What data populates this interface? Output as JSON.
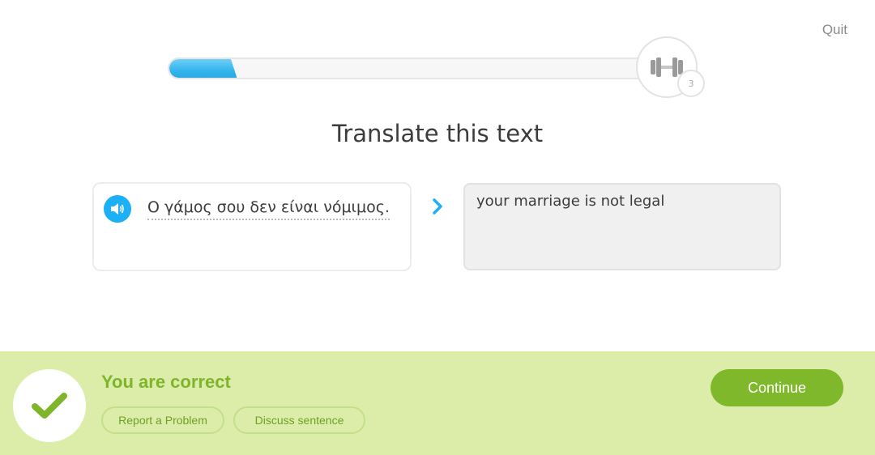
{
  "header": {
    "quit_label": "Quit",
    "progress": 0.14,
    "strength_icon": "dumbbell-icon",
    "strength_count": "3"
  },
  "exercise": {
    "title": "Translate this text",
    "prompt_text": "Ο γάμος σου δεν είναι νόμιμος.",
    "speaker_icon": "speaker-icon",
    "arrow_icon": "chevron-right-icon",
    "answer_text": "your marriage is not legal"
  },
  "result": {
    "status_icon": "checkmark-icon",
    "title": "You are correct",
    "report_label": "Report a Problem",
    "discuss_label": "Discuss sentence",
    "continue_label": "Continue"
  },
  "colors": {
    "progress_blue": "#35b5ee",
    "banner_bg": "#dcedaa",
    "correct_green": "#7eb52b",
    "continue_green": "#7fb82a"
  }
}
